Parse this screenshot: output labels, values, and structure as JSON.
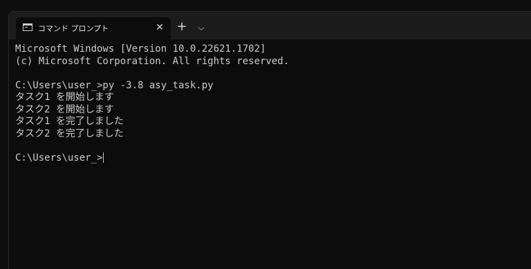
{
  "window": {
    "tab_title": "コマンド プロンプト",
    "tab_icon": "terminal-icon",
    "close_glyph": "✕",
    "new_tab_glyph": "+",
    "dropdown_glyph": "⌵"
  },
  "terminal": {
    "lines": [
      "Microsoft Windows [Version 10.0.22621.1702]",
      "(c) Microsoft Corporation. All rights reserved.",
      "",
      "C:\\Users\\user_>py -3.8 asy_task.py",
      "タスク1 を開始します",
      "タスク2 を開始します",
      "タスク1 を完了しました",
      "タスク2 を完了しました",
      "",
      "C:\\Users\\user_>"
    ]
  },
  "colors": {
    "background": "#0c0c0c",
    "tabbar": "#1c1c1c",
    "text": "#cccccc"
  }
}
